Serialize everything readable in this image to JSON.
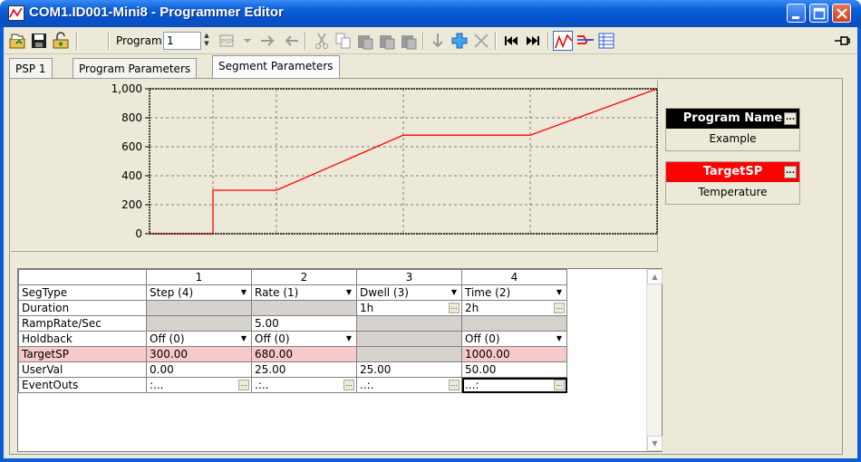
{
  "window": {
    "title": "COM1.ID001-Mini8 - Programmer Editor"
  },
  "toolbar": {
    "program_label": "Program:",
    "program_value": "1",
    "icons": [
      "open-icon",
      "save-icon",
      "unlock-icon",
      "psp-icon",
      "move-right-icon",
      "move-left-icon",
      "cut-icon",
      "copy-icon",
      "paste-icon",
      "paste-before-icon",
      "paste-after-icon",
      "insert-down-icon",
      "add-segment-icon",
      "delete-segment-icon",
      "first-segment-icon",
      "last-segment-icon",
      "chart-view-icon",
      "parameters-view-icon",
      "table-view-icon",
      "pin-icon"
    ]
  },
  "tabs": [
    {
      "label": "PSP 1"
    },
    {
      "label": "Program Parameters"
    },
    {
      "label": "Segment Parameters"
    }
  ],
  "chart_data": {
    "type": "line",
    "series": [
      {
        "x": [
          0,
          1,
          1,
          2,
          4,
          6,
          8
        ],
        "y": [
          0,
          0,
          300,
          300,
          680,
          680,
          1000
        ]
      }
    ],
    "ylim": [
      0,
      1000
    ],
    "yticks": [
      "1,000",
      "800",
      "600",
      "400",
      "200",
      "0"
    ],
    "grid": true,
    "colors": {
      "line": "#ff0000",
      "border": "#000000",
      "grid": "#808080"
    }
  },
  "side": {
    "program_name_header": "Program Name",
    "program_name_value": "Example",
    "target_header": "TargetSP",
    "target_value": "Temperature",
    "program_name_color": "#000000",
    "target_color": "#ff0000"
  },
  "grid": {
    "columns": [
      "1",
      "2",
      "3",
      "4"
    ],
    "rows": [
      {
        "label": "SegType",
        "cells": [
          "Step (4)",
          "Rate (1)",
          "Dwell (3)",
          "Time (2)"
        ]
      },
      {
        "label": "Duration",
        "cells": [
          "",
          "",
          "1h",
          "2h"
        ]
      },
      {
        "label": "RampRate/Sec",
        "cells": [
          "",
          "5.00",
          "",
          ""
        ]
      },
      {
        "label": "Holdback",
        "cells": [
          "Off (0)",
          "Off (0)",
          "",
          "Off (0)"
        ]
      },
      {
        "label": "TargetSP",
        "cells": [
          "300.00",
          "680.00",
          "",
          "1000.00"
        ]
      },
      {
        "label": "UserVal",
        "cells": [
          "0.00",
          "25.00",
          "25.00",
          "50.00"
        ]
      },
      {
        "label": "EventOuts",
        "cells": [
          ":...",
          ".:..",
          "..:.",
          "...:"
        ]
      }
    ]
  }
}
